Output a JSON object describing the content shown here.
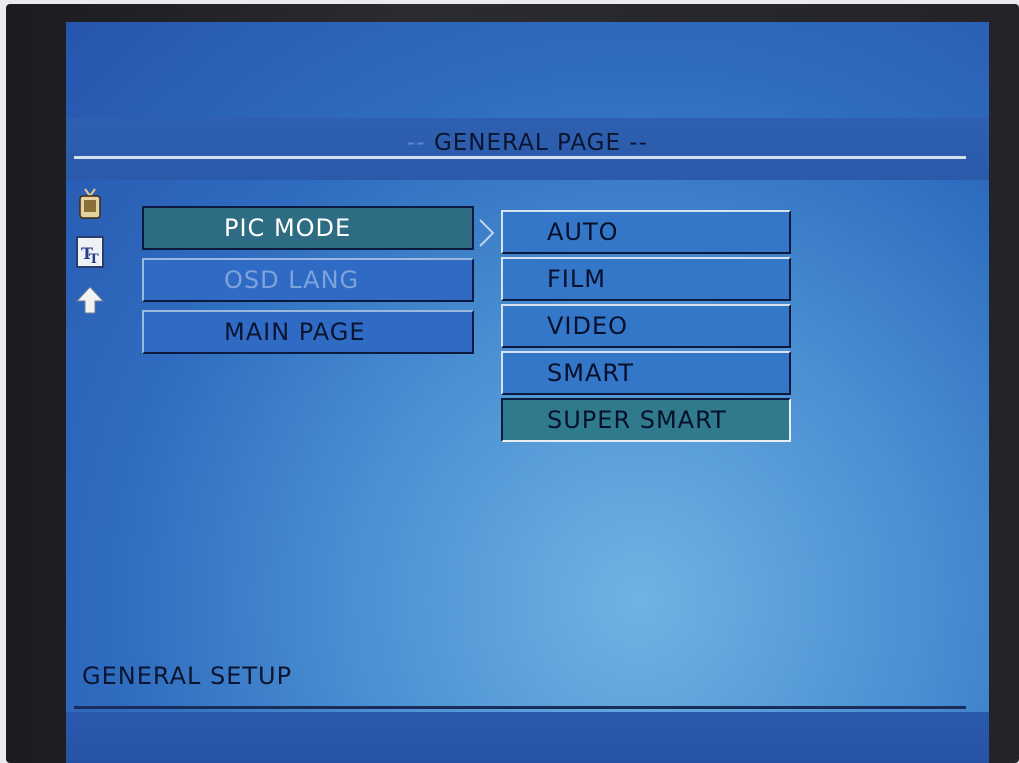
{
  "page_title_prefix": "--",
  "page_title_main": "GENERAL PAGE --",
  "menu": {
    "items": [
      {
        "label": "PIC MODE"
      },
      {
        "label": "OSD LANG"
      },
      {
        "label": "MAIN PAGE"
      }
    ]
  },
  "submenu": {
    "items": [
      {
        "label": "AUTO"
      },
      {
        "label": "FILM"
      },
      {
        "label": "VIDEO"
      },
      {
        "label": "SMART"
      },
      {
        "label": "SUPER SMART"
      }
    ]
  },
  "footer_label": "GENERAL SETUP",
  "icons": [
    "tv-icon",
    "font-icon",
    "up-arrow-icon"
  ],
  "colors": {
    "screen_blue": "#2e6cbf",
    "highlight_teal": "#2e6c84",
    "text_dark": "#0b1530",
    "text_white": "#ffffff"
  }
}
